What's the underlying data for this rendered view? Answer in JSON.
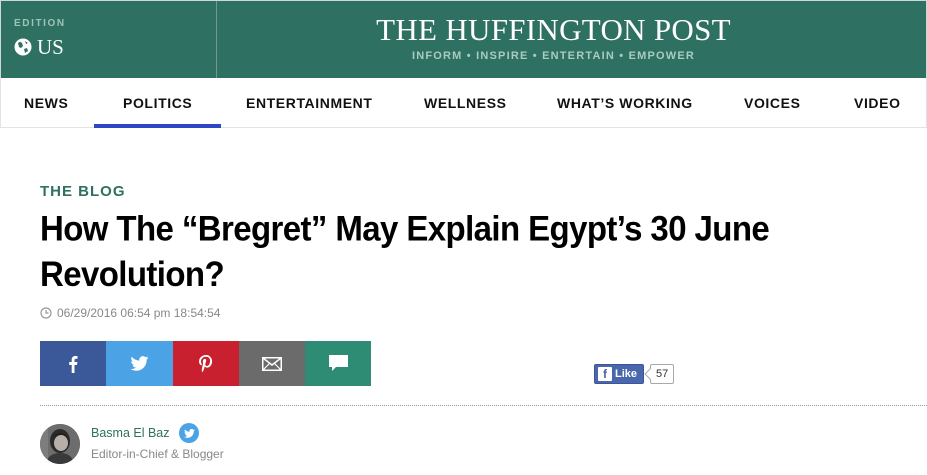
{
  "header": {
    "edition_label": "EDITION",
    "edition_value": "US",
    "logo_title": "THE HUFFINGTON POST",
    "tagline": "INFORM • INSPIRE • ENTERTAIN • EMPOWER",
    "brand_color": "#2e7061"
  },
  "nav": {
    "items": [
      {
        "label": "NEWS"
      },
      {
        "label": "POLITICS",
        "active": true
      },
      {
        "label": "ENTERTAINMENT"
      },
      {
        "label": "WELLNESS"
      },
      {
        "label": "WHAT’S WORKING"
      },
      {
        "label": "VOICES"
      },
      {
        "label": "VIDEO"
      }
    ],
    "active_color": "#2d47c5"
  },
  "article": {
    "section": "THE BLOG",
    "headline": "How The “Bregret” May Explain Egypt’s 30 June Revolution?",
    "timestamp": "06/29/2016 06:54 pm 18:54:54",
    "timestamp_icon": "clock-icon"
  },
  "share": {
    "buttons": [
      {
        "name": "facebook",
        "icon": "facebook-icon",
        "color": "#3b5998"
      },
      {
        "name": "twitter",
        "icon": "twitter-icon",
        "color": "#4ba3e6"
      },
      {
        "name": "pinterest",
        "icon": "pinterest-icon",
        "color": "#c8202e"
      },
      {
        "name": "email",
        "icon": "envelope-icon",
        "color": "#6b6b6b"
      },
      {
        "name": "comment",
        "icon": "comment-icon",
        "color": "#2e8b74"
      }
    ],
    "fb_like_label": "Like",
    "fb_like_count": "57"
  },
  "author": {
    "name": "Basma El Baz",
    "role": "Editor-in-Chief & Blogger",
    "badge_icon": "twitter-icon"
  }
}
